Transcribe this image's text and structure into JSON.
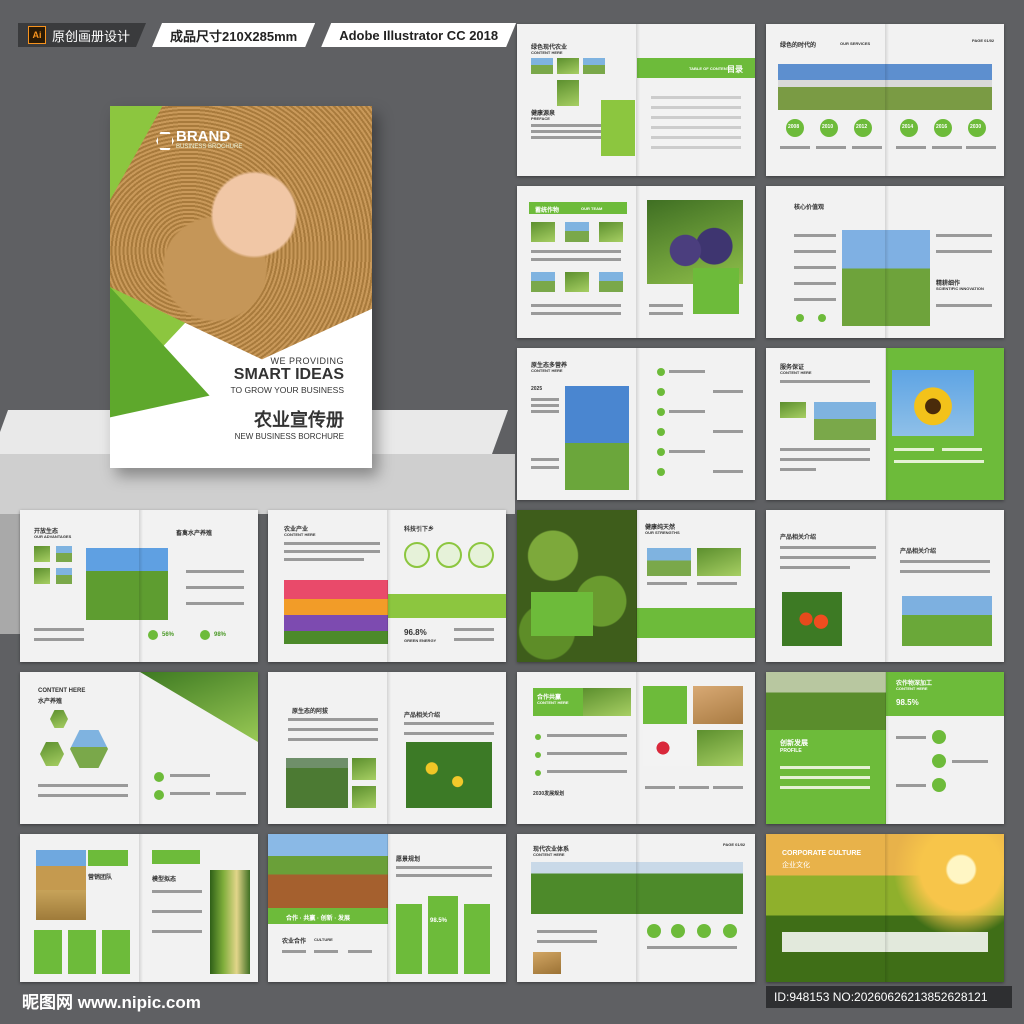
{
  "header": {
    "ai_badge": "Ai",
    "tag1": "原创画册设计",
    "tag2": "成品尺寸210X285mm",
    "tag3": "Adobe Illustrator CC 2018"
  },
  "cover": {
    "brand": "BRAND",
    "brand_sub": "BUSINESS BROCHURE",
    "we_providing": "WE PROVIDING",
    "smart_ideas": "SMART IDEAS",
    "grow": "TO GROW YOUR BUSINESS",
    "title_cn": "农业宣传册",
    "subtitle": "NEW BUSINESS BORCHURE"
  },
  "spreads": {
    "s1": {
      "title": "绿色现代农业",
      "sub": "CONTENT HERE",
      "toc": "目录",
      "toc_sub": "TABLE OF CONTENTS",
      "preface": "健康源泉",
      "preface_sub": "PREFACE"
    },
    "s2": {
      "title": "绿色的时代的",
      "sub": "OUR SERVICES",
      "page": "PAGE 01/02",
      "years": [
        "2008",
        "2010",
        "2012",
        "2014",
        "2016",
        "2030"
      ]
    },
    "s3": {
      "title": "蓄统作物",
      "sub": "OUR TEAM"
    },
    "s4": {
      "title": "核心价值观",
      "label": "精耕细作",
      "label_sub": "SCIENTIFIC INNOVATION"
    },
    "s5": {
      "title": "原生态多营养",
      "sub": "CONTENT HERE",
      "year": "2025"
    },
    "s6": {
      "title": "服务保证",
      "sub": "CONTENT HERE"
    },
    "s7": {
      "title": "开放生态",
      "sub": "OUR ADVANTAGES",
      "right": "畜禽水产养殖",
      "p1": "56%",
      "p2": "98%"
    },
    "s8": {
      "title": "农业产业",
      "sub": "CONTENT HERE",
      "right": "科技引下乡",
      "pct": "96.8%",
      "pct_sub": "GREEN ENERGY"
    },
    "s9": {
      "title": "健康纯天然",
      "sub": "OUR STRENGTHS"
    },
    "s10": {
      "title": "产品相关介绍",
      "right": "产品相关介绍"
    },
    "s11": {
      "title": "CONTENT HERE",
      "sub": "水产养殖"
    },
    "s12": {
      "title": "原生态的阿拔",
      "right": "产品相关介绍"
    },
    "s13": {
      "title": "合作共赢",
      "sub": "CONTENT HERE",
      "year": "2030发展规划"
    },
    "s14": {
      "title": "农作物深加工",
      "sub": "CONTENT HERE",
      "pct": "98.5%",
      "profile": "创新发展",
      "profile_sub": "PROFILE"
    },
    "s15": {
      "title": "营销团队",
      "right": "模型拟态"
    },
    "s16": {
      "slogan": "合作 · 共赢 · 创新 · 发展",
      "title": "愿景规划",
      "pct": "98.5%",
      "culture": "农业合作",
      "culture_sub": "CULTURE"
    },
    "s17": {
      "title": "现代农业体系",
      "sub": "CONTENT HERE",
      "page": "PAGE 01/02"
    },
    "s18": {
      "title": "CORPORATE CULTURE",
      "sub": "企业文化"
    }
  },
  "footer": {
    "site": "昵图网 www.nipic.com",
    "id": "ID:948153 NO:20260626213852628121"
  }
}
